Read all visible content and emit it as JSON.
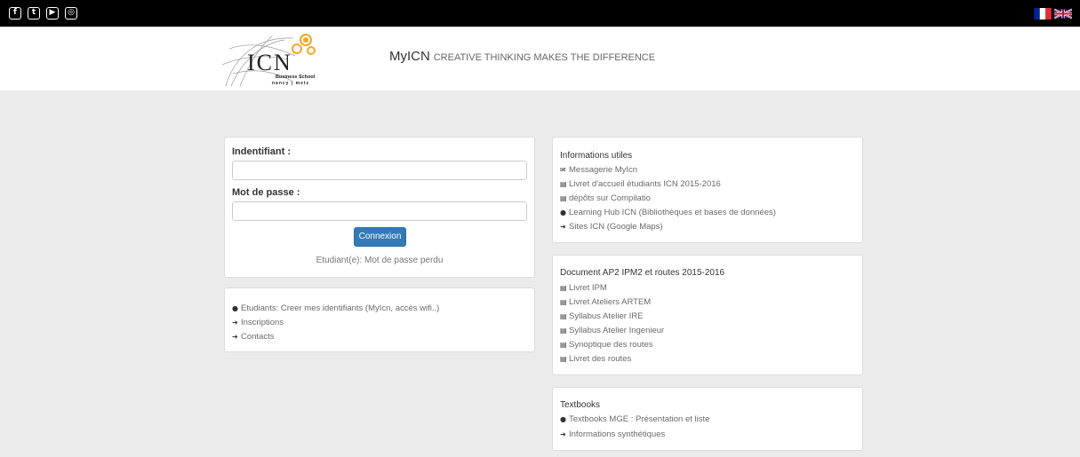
{
  "topbar": {
    "social": [
      {
        "name": "facebook-icon",
        "glyph": "f"
      },
      {
        "name": "twitter-icon",
        "glyph": "t"
      },
      {
        "name": "youtube-icon",
        "glyph": "▶"
      },
      {
        "name": "instagram-icon",
        "glyph": "◎"
      }
    ],
    "languages": [
      "fr",
      "en"
    ]
  },
  "header": {
    "logo_text": "ICN",
    "logo_sub": "Business School",
    "logo_cities": "nancy | metz",
    "brand": "MyICN",
    "motto": "CREATIVE THINKING MAKES THE DIFFERENCE"
  },
  "login": {
    "username_label": "Indentifiant :",
    "username_value": "",
    "password_label": "Mot de passe :",
    "password_value": "",
    "submit_label": "Connexion",
    "lost_password": "Etudiant(e): Mot de passe perdu"
  },
  "links": {
    "items": [
      {
        "icon": "globe-icon",
        "glyph": "●",
        "label": "Etudiants: Creer mes identifiants (MyIcn, accès wifi..)"
      },
      {
        "icon": "arrow-circle-icon",
        "glyph": "➜",
        "label": "Inscriptions"
      },
      {
        "icon": "arrow-circle-icon",
        "glyph": "➜",
        "label": "Contacts"
      }
    ]
  },
  "infos": {
    "title": "Informations utiles",
    "items": [
      {
        "icon": "envelope-icon",
        "glyph": "✉",
        "label": "Messagerie MyIcn"
      },
      {
        "icon": "file-pdf-icon",
        "glyph": "▤",
        "label": "Livret d'accueil étudiants ICN 2015-2016"
      },
      {
        "icon": "file-pdf-icon",
        "glyph": "▤",
        "label": "dépôts sur Compilatio"
      },
      {
        "icon": "globe-icon",
        "glyph": "●",
        "label": "Learning Hub ICN (Bibliothèques et bases de données)"
      },
      {
        "icon": "arrow-circle-icon",
        "glyph": "➜",
        "label": "Sites ICN (Google Maps)"
      }
    ]
  },
  "documents": {
    "title": "Document AP2 IPM2 et routes 2015-2016",
    "items": [
      {
        "icon": "file-pdf-icon",
        "glyph": "▤",
        "label": "Livret IPM"
      },
      {
        "icon": "file-pdf-icon",
        "glyph": "▤",
        "label": "Livret Ateliers ARTEM"
      },
      {
        "icon": "file-pdf-icon",
        "glyph": "▤",
        "label": "Syllabus Atelier IRE"
      },
      {
        "icon": "file-pdf-icon",
        "glyph": "▤",
        "label": "Syllabus Atelier Ingenieur"
      },
      {
        "icon": "file-pdf-icon",
        "glyph": "▤",
        "label": "Synoptique des routes"
      },
      {
        "icon": "file-pdf-icon",
        "glyph": "▤",
        "label": "Livret des routes"
      }
    ]
  },
  "textbooks": {
    "title": "Textbooks",
    "items": [
      {
        "icon": "globe-icon",
        "glyph": "●",
        "label": "Textbooks MGE : Présentation et liste"
      },
      {
        "icon": "arrow-circle-icon",
        "glyph": "➜",
        "label": "Informations synthétiques"
      }
    ]
  },
  "colors": {
    "topbar": "#000000",
    "background": "#ebebeb",
    "button": "#337ab7",
    "logo_accent": "#f5a623"
  }
}
